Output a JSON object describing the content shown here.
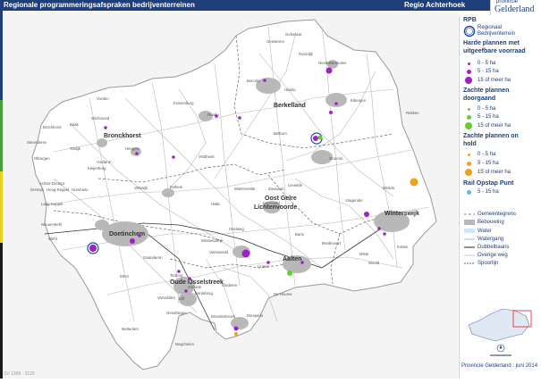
{
  "header": {
    "title": "Regionale programmeringsafspraken bedrijventerreinen",
    "region": "Regio Achterhoek",
    "logo_small": "provincie",
    "logo_big": "Gelderland"
  },
  "colors": {
    "header_bg": "#1f3f7a",
    "harde": "#a020c8",
    "zachte": "#66cc33",
    "onhold": "#f0a020",
    "rail": "#66b8e0",
    "rpb": "#1a4aa8",
    "built": "#b8b8b8",
    "outside": "#f4f4f4",
    "region": "#ffffff"
  },
  "legend": {
    "rpb_title": "RPB",
    "rpb_item": "Regionaal Bedrijventerrein",
    "harde_title": "Harde plannen met uitgeefbare voorraad",
    "harde_items": [
      "0 - 5 ha",
      "5 - 15 ha",
      "15 of meer ha"
    ],
    "zachte_title": "Zachte plannen doorgaand",
    "zachte_items": [
      "0 - 5 ha",
      "5 - 15 ha",
      "15 of meer ha"
    ],
    "onhold_title": "Zachte plannen on hold",
    "onhold_items": [
      "0 - 5 ha",
      "5 - 15 ha",
      "15 of meer ha"
    ],
    "rail_title": "Rail Opstap Punt",
    "rail_items": [
      "5 - 15 ha"
    ],
    "base_items": [
      "Gemeentegrens",
      "Bebouwing",
      "Water",
      "Watergang",
      "Dubbelbaans",
      "Overige weg",
      "Spoorlijn"
    ]
  },
  "footer": "Provincie Gelderland : juni 2014",
  "ref": "SV 1309 - 3125",
  "municipalities": [
    "Berkelland",
    "Bronckhorst",
    "Oost Gelre",
    "Lichtenvoorde",
    "Winterswijk",
    "Doetinchem",
    "Oude IJsselstreek",
    "Aalten"
  ],
  "places": [
    "Geesteren",
    "Noordijk",
    "Gelselaar",
    "Neede",
    "Rietmolen",
    "Borculo",
    "Haarlo",
    "Eibergen",
    "Rekken",
    "Vorden",
    "Kranenburg",
    "Ruurlo",
    "Beltrum",
    "Groenlo",
    "Brockhorst",
    "Baak",
    "Wichmond",
    "Steenderen",
    "Toldijk",
    "Hengelo",
    "Olburgen",
    "Keijenborg",
    "Veldhoek",
    "Achter-Drempt",
    "Drempt",
    "Hoog-Keppel",
    "Hummelo",
    "Vorden2",
    "Laag-Keppel",
    "Zelhem",
    "Velswijk",
    "Mariënvelde",
    "Zieuwent",
    "Lievelde",
    "Vragender",
    "Meddo",
    "Halle",
    "Harreveld",
    "Nieuw-Wehl",
    "Wehl",
    "Heelweg",
    "Westendorp",
    "Varsseveld",
    "Barlo",
    "Bredevoort",
    "Miste",
    "Kotten",
    "Woold",
    "Gaanderen",
    "Terborg",
    "Silvolde",
    "Etten",
    "Bontebrug",
    "Lintelo",
    "Sinderen",
    "De Heurne",
    "Ulft",
    "Varsselder",
    "Dinxperlo",
    "Breedenbroek",
    "Netterden",
    "Megchelen",
    "Gendringen"
  ]
}
